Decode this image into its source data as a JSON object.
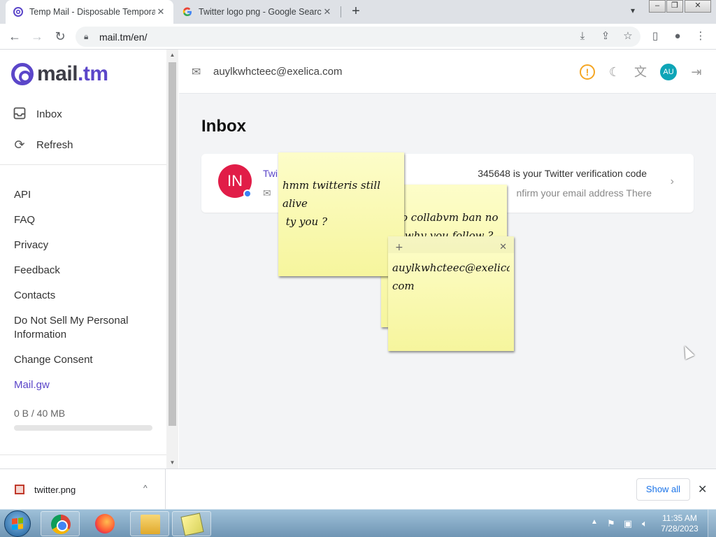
{
  "browser": {
    "tabs": [
      {
        "title": "Temp Mail - Disposable Tempora",
        "active": true
      },
      {
        "title": "Twitter logo png - Google Search",
        "active": false
      }
    ],
    "url": "mail.tm/en/"
  },
  "sidebar": {
    "brand_prefix": "mail",
    "brand_suffix": ".tm",
    "nav": [
      {
        "label": "Inbox",
        "icon": "inbox-icon"
      },
      {
        "label": "Refresh",
        "icon": "refresh-icon"
      }
    ],
    "links": [
      "API",
      "FAQ",
      "Privacy",
      "Feedback",
      "Contacts",
      "Do Not Sell My Personal Information",
      "Change Consent",
      "Mail.gw"
    ],
    "storage_text": "0 B  / 40 MB",
    "storage_fraction": 0.0
  },
  "header": {
    "email": "auylkwhcteec@exelica.com",
    "avatar_initials": "AU",
    "icons": [
      "warning-icon",
      "moon-icon",
      "translate-icon",
      "logout-icon"
    ]
  },
  "inbox": {
    "title": "Inbox",
    "message": {
      "avatar_initials": "IN",
      "sender": "Twi",
      "subject": "345648 is your Twitter verification code",
      "preview": "nfirm your email address There"
    }
  },
  "sticky_notes": [
    {
      "text": "hmm twitteris still alive\n ty you ?"
    },
    {
      "text": "o collabvm ban no\n why you follow ?"
    },
    {
      "text": "auylkwhcteec@exelica.\ncom"
    }
  ],
  "downloads": {
    "filename": "twitter.png",
    "show_all": "Show all"
  },
  "taskbar": {
    "time": "11:35 AM",
    "date": "7/28/2023"
  },
  "colors": {
    "accent": "#5b46c9",
    "avatar_in": "#e11d48",
    "avatar_au": "#0ea5b7",
    "note": "#f6f59d"
  }
}
